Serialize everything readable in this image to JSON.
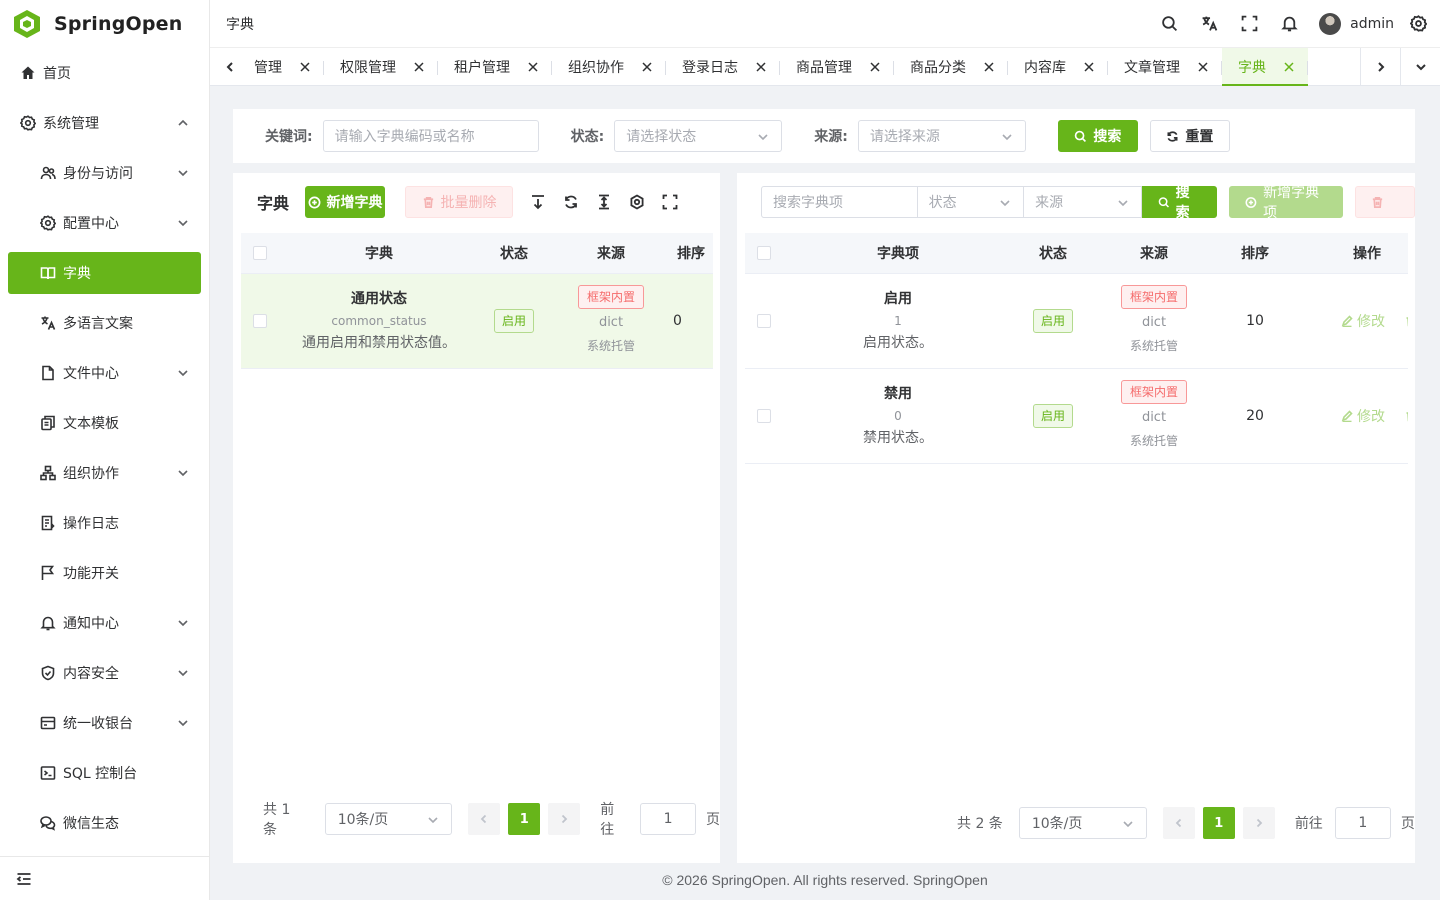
{
  "app": {
    "name": "SpringOpen",
    "brand_color": "#67b51a"
  },
  "sidebar": {
    "items": [
      {
        "label": "首页",
        "icon": "home-icon"
      },
      {
        "label": "系统管理",
        "icon": "gear-icon",
        "expanded": true
      },
      {
        "label": "身份与访问",
        "icon": "users-icon"
      },
      {
        "label": "配置中心",
        "icon": "settings-icon"
      },
      {
        "label": "字典",
        "icon": "book-icon",
        "active": true
      },
      {
        "label": "多语言文案",
        "icon": "translate-icon"
      },
      {
        "label": "文件中心",
        "icon": "file-icon"
      },
      {
        "label": "文本模板",
        "icon": "copy-icon"
      },
      {
        "label": "组织协作",
        "icon": "org-icon"
      },
      {
        "label": "操作日志",
        "icon": "log-icon"
      },
      {
        "label": "功能开关",
        "icon": "flag-icon"
      },
      {
        "label": "通知中心",
        "icon": "bell-icon"
      },
      {
        "label": "内容安全",
        "icon": "shield-icon"
      },
      {
        "label": "统一收银台",
        "icon": "wallet-icon"
      },
      {
        "label": "SQL 控制台",
        "icon": "terminal-icon"
      },
      {
        "label": "微信生态",
        "icon": "chat-icon"
      }
    ]
  },
  "header": {
    "breadcrumb": "字典",
    "username": "admin"
  },
  "tabs": [
    {
      "label": "管理"
    },
    {
      "label": "权限管理"
    },
    {
      "label": "租户管理"
    },
    {
      "label": "组织协作"
    },
    {
      "label": "登录日志"
    },
    {
      "label": "商品管理"
    },
    {
      "label": "商品分类"
    },
    {
      "label": "内容库"
    },
    {
      "label": "文章管理"
    },
    {
      "label": "字典",
      "active": true
    }
  ],
  "search": {
    "keyword_label": "关键词:",
    "keyword_placeholder": "请输入字典编码或名称",
    "status_label": "状态:",
    "status_placeholder": "请选择状态",
    "source_label": "来源:",
    "source_placeholder": "请选择来源",
    "search_btn": "搜索",
    "reset_btn": "重置"
  },
  "left_panel": {
    "title": "字典",
    "add_btn": "新增字典",
    "batch_delete_btn": "批量删除",
    "columns": [
      "字典",
      "状态",
      "来源",
      "排序"
    ],
    "rows": [
      {
        "name": "通用状态",
        "code": "common_status",
        "desc": "通用启用和禁用状态值。",
        "status": "启用",
        "source_tag": "框架内置",
        "source_type": "dict",
        "source_owner": "系统托管",
        "sort": "0"
      }
    ],
    "pager": {
      "total": "共 1 条",
      "page_size": "10条/页",
      "current": "1",
      "goto_label": "前往",
      "goto_value": "1",
      "page_suffix": "页"
    }
  },
  "right_panel": {
    "search_placeholder": "搜索字典项",
    "status_placeholder": "状态",
    "source_placeholder": "来源",
    "search_btn": "搜索",
    "add_btn": "新增字典项",
    "columns": [
      "字典项",
      "状态",
      "来源",
      "排序",
      "操作"
    ],
    "rows": [
      {
        "name": "启用",
        "value": "1",
        "desc": "启用状态。",
        "status": "启用",
        "source_tag": "框架内置",
        "source_type": "dict",
        "source_owner": "系统托管",
        "sort": "10",
        "edit": "修改",
        "delete": "删"
      },
      {
        "name": "禁用",
        "value": "0",
        "desc": "禁用状态。",
        "status": "启用",
        "source_tag": "框架内置",
        "source_type": "dict",
        "source_owner": "系统托管",
        "sort": "20",
        "edit": "修改",
        "delete": "删"
      }
    ],
    "pager": {
      "total": "共 2 条",
      "page_size": "10条/页",
      "current": "1",
      "goto_label": "前往",
      "goto_value": "1",
      "page_suffix": "页"
    }
  },
  "footer": "© 2026 SpringOpen. All rights reserved. SpringOpen"
}
